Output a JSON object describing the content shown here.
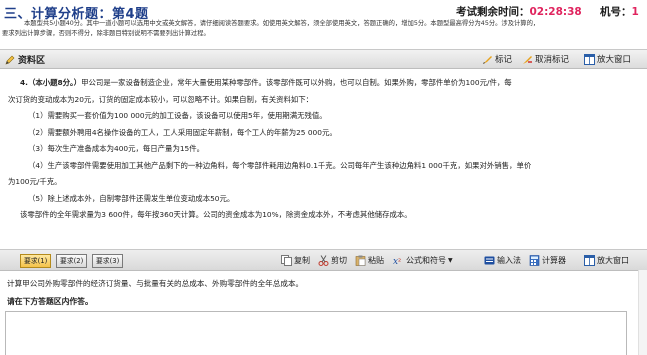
{
  "header": {
    "section_title": "三、计算分析题：",
    "question_label": "第4题",
    "timer_label": "考试剩余时间：",
    "timer_value": "02:28:38",
    "machine_label": "机号：",
    "machine_value": "1",
    "instructions_line1": "本题型共5小题40分。其中一道小题可以选用中文或英文解答，请仔细阅读答题要求。如使用英文解答，须全部使用英文，答题正确的，增加5分。本题型最高得分为45分。涉及计算的，",
    "instructions_line2": "要求列出计算步骤，否则不得分，除非题目特别说明不需要列出计算过程。"
  },
  "material_bar": {
    "title": "资料区",
    "mark_label": "标记",
    "unmark_label": "取消标记",
    "enlarge_label": "放大窗口"
  },
  "material": {
    "q_number": "4.（本小题8分。）",
    "intro_1": "甲公司是一家设备制造企业，常年大量使用某种零部件。该零部件既可以外购，也可以自制。如果外购，零部件单价为100元/件，每",
    "intro_2": "次订货的变动成本为20元，订货的固定成本较小，可以忽略不计。如果自制，有关资料如下：",
    "item1": "（1）需要购买一套价值为100 000元的加工设备，该设备可以使用5年，使用期满无残值。",
    "item2": "（2）需要额外聘用4名操作设备的工人，工人采用固定年薪制，每个工人的年薪为25 000元。",
    "item3": "（3）每次生产准备成本为400元，每日产量为15件。",
    "item4_1": "（4）生产该零部件需要使用加工其他产品剩下的一种边角料，每个零部件耗用边角料0.1千克。公司每年产生该种边角料1 000千克，如果对外销售，单价",
    "item4_2": "为100元/千克。",
    "item5": "（5）除上述成本外，自制零部件还需发生单位变动成本50元。",
    "closing": "该零部件的全年需求量为3 600件，每年按360天计算。公司的资金成本为10%，除资金成本外，不考虑其他储存成本。"
  },
  "requirements_bar": {
    "tabs": [
      "要求(1)",
      "要求(2)",
      "要求(3)"
    ],
    "copy_label": "复制",
    "cut_label": "剪切",
    "paste_label": "粘贴",
    "formula_label": "公式和符号",
    "input_label": "输入法",
    "calc_label": "计算器",
    "enlarge_label": "放大窗口"
  },
  "requirement": {
    "text": "计算甲公司外购零部件的经济订货量、与批量有关的总成本、外购零部件的全年总成本。",
    "answer_prompt": "请在下方答题区内作答。"
  },
  "colors": {
    "title_blue": "#1f3f8a",
    "timer_red": "#e0245e",
    "active_tab": "#f4c24a"
  }
}
